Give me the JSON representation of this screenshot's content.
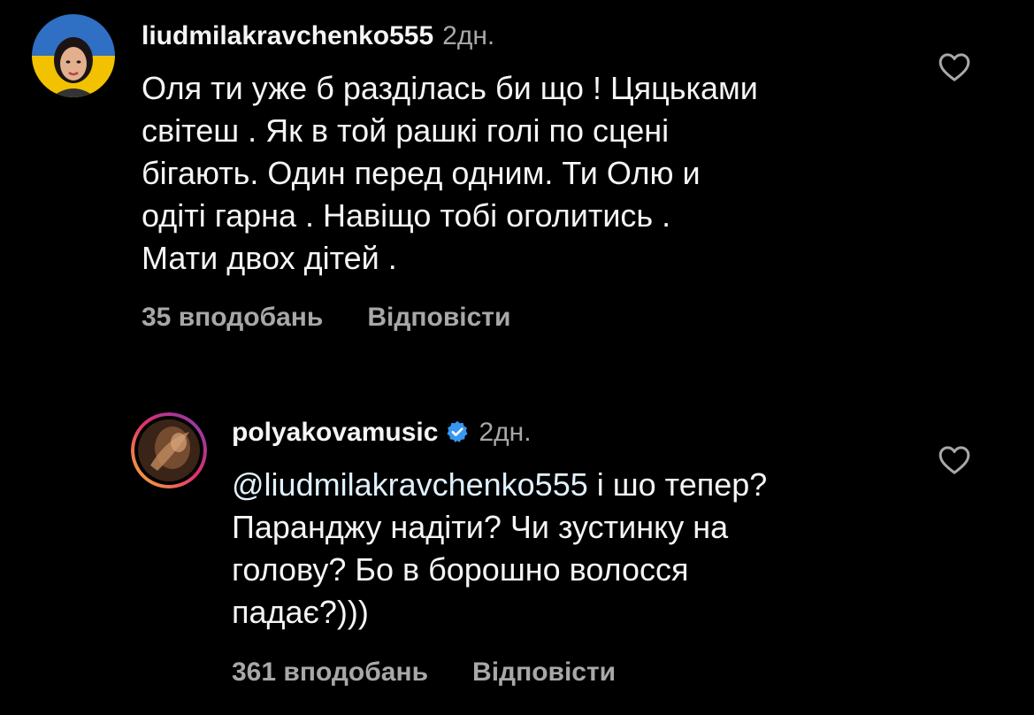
{
  "comments": [
    {
      "username": "liudmilakravchenko555",
      "time": "2дн.",
      "text": "Оля ти уже б разділась би що ! Цяцьками\nсвітеш . Як в той рашкі голі по сцені\nбігають. Один перед одним. Ти Олю и\nодіті гарна . Навіщо тобі оголитись .\nМати двох дітей .",
      "likes": "35 вподобань",
      "reply_label": "Відповісти"
    },
    {
      "username": "polyakovamusic",
      "time": "2дн.",
      "mention": "@liudmilakravchenko555",
      "text": "  і шо тепер?\nПаранджу надіти? Чи зустинку на\nголову? Бо в борошно волосся\nпадає?)))",
      "likes": "361 вподобань",
      "reply_label": "Відповісти"
    }
  ],
  "icons": {
    "like": "heart-outline-icon",
    "verified": "verified-badge-icon"
  },
  "colors": {
    "background": "#000000",
    "text": "#f5f5f5",
    "secondary": "#a8a8a8",
    "mention": "#e0f1ff",
    "verified": "#3897f0"
  }
}
